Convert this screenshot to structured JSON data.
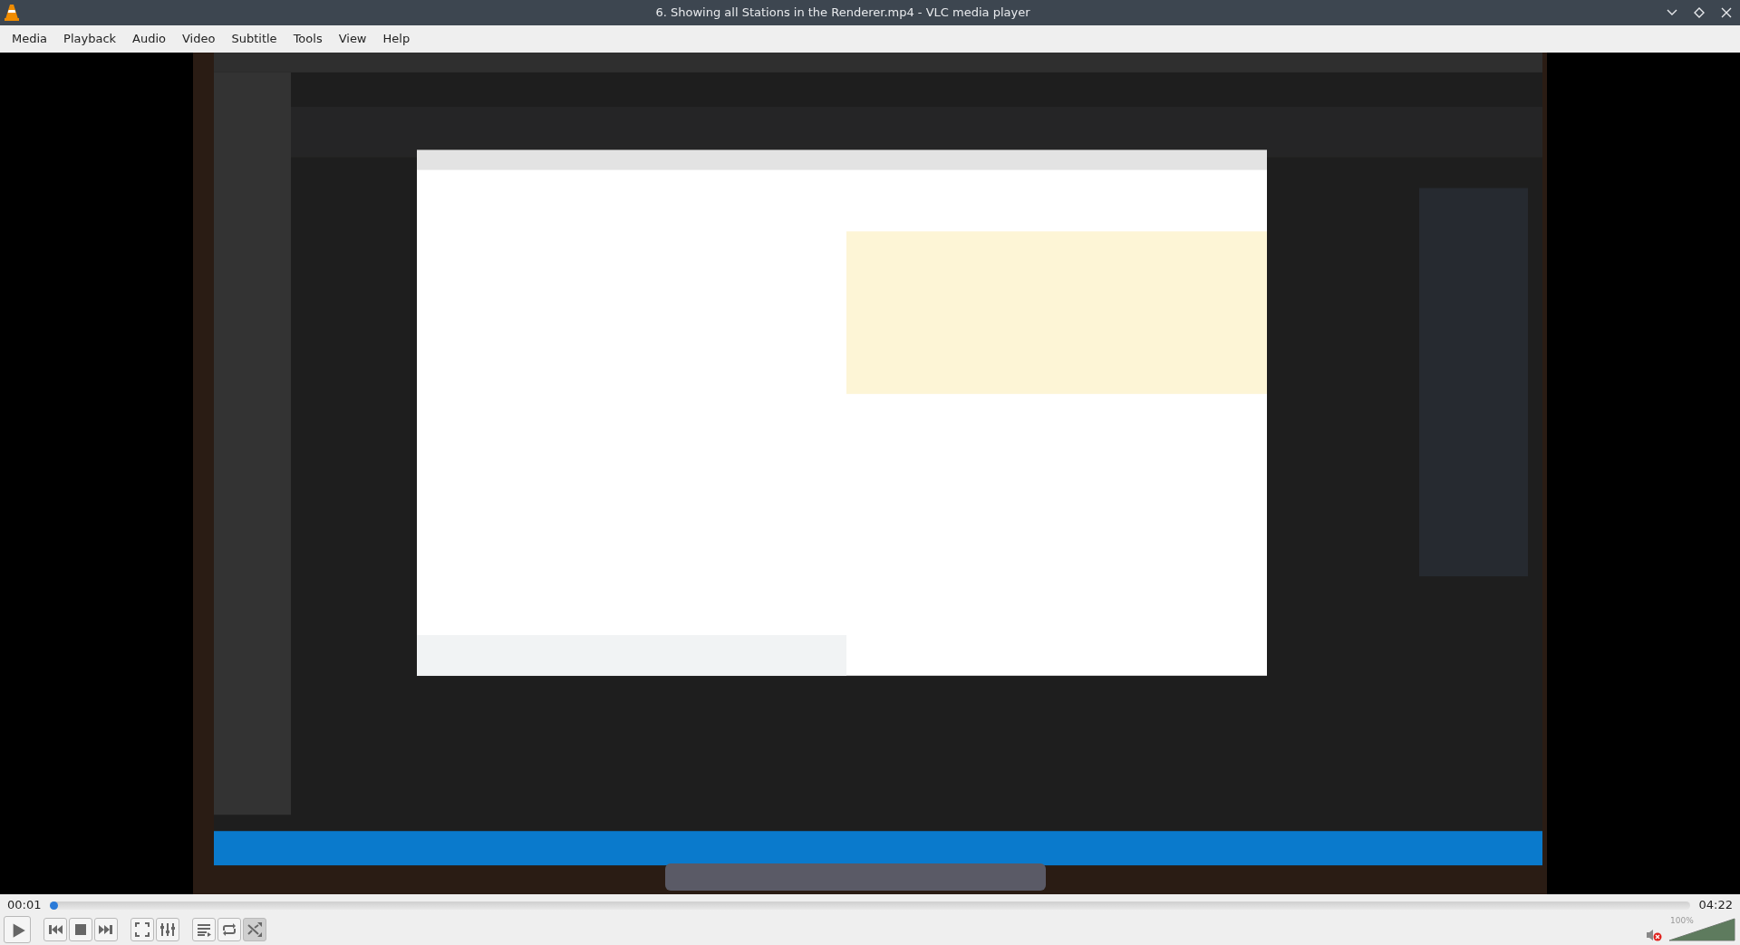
{
  "window": {
    "title": "6. Showing all Stations in the Renderer.mp4 - VLC media player"
  },
  "menu": [
    "Media",
    "Playback",
    "Audio",
    "Video",
    "Subtitle",
    "Tools",
    "View",
    "Help"
  ],
  "video": {
    "kind": "picture"
  },
  "seek": {
    "elapsed": "00:01",
    "total": "04:22",
    "level": 0.004
  },
  "controls": [
    {
      "kind": "play",
      "on": false
    },
    {
      "kind": "previous",
      "on": false
    },
    {
      "kind": "stop",
      "on": false
    },
    {
      "kind": "next",
      "on": false
    },
    {
      "kind": "fullscreen",
      "on": false
    },
    {
      "kind": "settings",
      "on": false
    },
    {
      "kind": "playlist",
      "on": false
    },
    {
      "kind": "loop",
      "on": false
    },
    {
      "kind": "shuffle",
      "on": true
    }
  ],
  "volume": {
    "muted": true,
    "level": 1.0,
    "reading": "100%"
  }
}
